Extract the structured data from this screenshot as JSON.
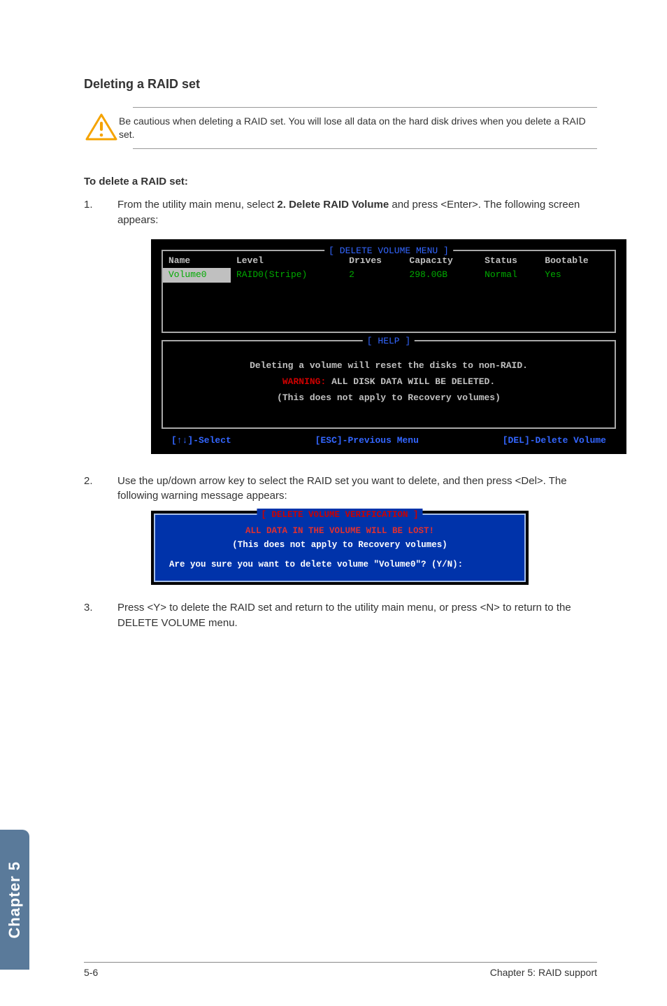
{
  "heading": "Deleting a RAID set",
  "caution": "Be cautious when deleting a RAID set. You will lose all data on the hard disk drives when you delete a RAID set.",
  "sub_heading": "To delete a RAID set:",
  "steps": {
    "s1_num": "1.",
    "s1_a": "From the utility main menu, select ",
    "s1_b": "2. Delete RAID Volume",
    "s1_c": " and press <Enter>. The following screen appears:",
    "s2_num": "2.",
    "s2": "Use the up/down arrow key to select the RAID set you want to delete, and then press <Del>. The following warning message appears:",
    "s3_num": "3.",
    "s3": "Press <Y> to delete the RAID set and return to the utility main menu, or press <N> to return to the DELETE VOLUME menu."
  },
  "bios": {
    "title": "[ DELETE VOLUME MENU ]",
    "headers": [
      "Name",
      "Level",
      "Drives",
      "Capacity",
      "Status",
      "Bootable"
    ],
    "row": [
      "Volume0",
      "RAID0(Stripe)",
      "2",
      "298.0GB",
      "Normal",
      "Yes"
    ],
    "help_title": "[ HELP ]",
    "help1": "Deleting a volume will reset the disks to non-RAID.",
    "help2a": "WARNING:",
    "help2b": " ALL DISK DATA WILL BE DELETED.",
    "help3": "(This does not apply to Recovery volumes)",
    "footer": [
      "[↑↓]-Select",
      "[ESC]-Previous Menu",
      "[DEL]-Delete Volume"
    ]
  },
  "dialog": {
    "title": "[ DELETE VOLUME VERIFICATION ]",
    "warn": "ALL DATA IN THE VOLUME WILL BE LOST!",
    "note": "(This does not apply to Recovery volumes)",
    "prompt": "Are you sure you want to delete volume \"Volume0\"? (Y/N):"
  },
  "side_tab": "Chapter 5",
  "footer_left": "5-6",
  "footer_right": "Chapter 5: RAID support"
}
